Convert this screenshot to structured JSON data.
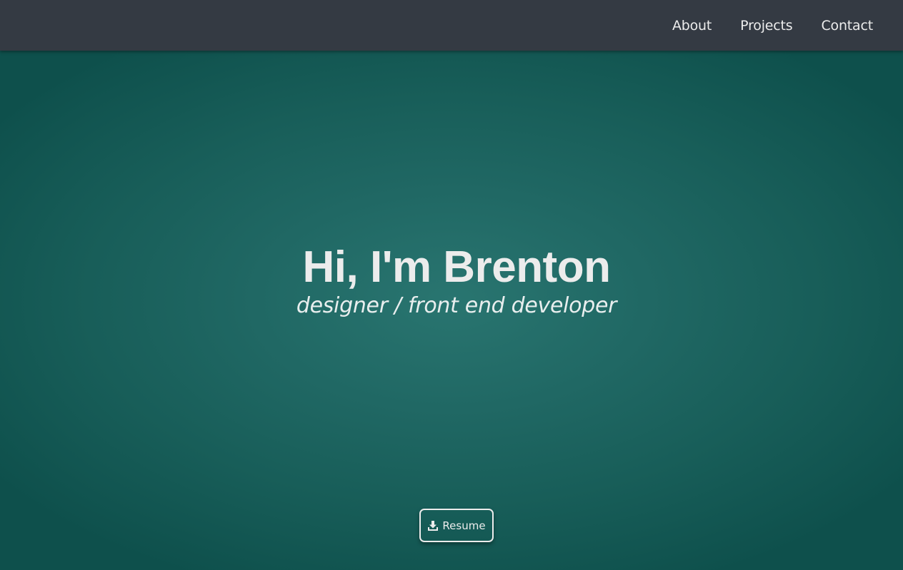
{
  "nav": {
    "links": [
      {
        "label": "About"
      },
      {
        "label": "Projects"
      },
      {
        "label": "Contact"
      }
    ]
  },
  "hero": {
    "title": "Hi, I'm Brenton",
    "subtitle": "designer / front end developer",
    "resume_button": {
      "label": "Resume",
      "icon": "download-icon"
    }
  },
  "colors": {
    "navbar_bg": "#343a43",
    "hero_center": "#297570",
    "hero_edge": "#0e504c",
    "text": "#ececec"
  }
}
